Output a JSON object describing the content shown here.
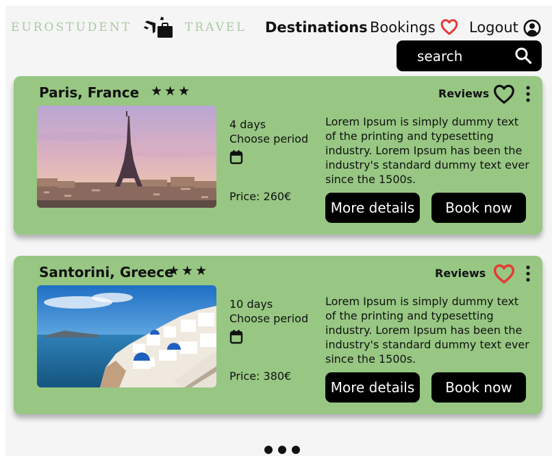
{
  "header": {
    "brand_left": "EUROSTUDENT",
    "brand_right": "TRAVEL",
    "logo_icon": "luggage-plane-icon",
    "nav": [
      {
        "label": "Destinations",
        "active": true
      },
      {
        "label": "Bookings",
        "active": false
      },
      {
        "label": "Logout",
        "active": false
      }
    ],
    "favorites_icon": "heart-icon",
    "account_icon": "user-circle-icon"
  },
  "search": {
    "placeholder": "search",
    "icon": "search-icon"
  },
  "destinations": [
    {
      "title": "Paris, France",
      "stars": "★★★",
      "image": "eiffel-tower-photo",
      "reviews_label": "Reviews",
      "favorite": false,
      "days": "4 days",
      "period_label": "Choose period",
      "price": "Price: 260€",
      "description": "Lorem Ipsum is simply dummy text of the printing and typesetting industry. Lorem Ipsum has been the industry's standard dummy text ever since the 1500s.",
      "more_label": "More details",
      "book_label": "Book now"
    },
    {
      "title": "Santorini, Greece",
      "stars": "★★★",
      "image": "santorini-photo",
      "reviews_label": "Reviews",
      "favorite": true,
      "days": "10 days",
      "period_label": "Choose period",
      "price": "Price: 380€",
      "description": "Lorem Ipsum is simply dummy text of the printing and typesetting industry. Lorem Ipsum has been the industry's standard dummy text ever since the 1500s.",
      "more_label": "More details",
      "book_label": "Book now"
    }
  ],
  "colors": {
    "card_background": "#97c783",
    "brand_text": "#a9c9a2",
    "heart_accent": "#e53935",
    "button_background": "#000000"
  },
  "pagination_icon": "ellipsis-icon"
}
